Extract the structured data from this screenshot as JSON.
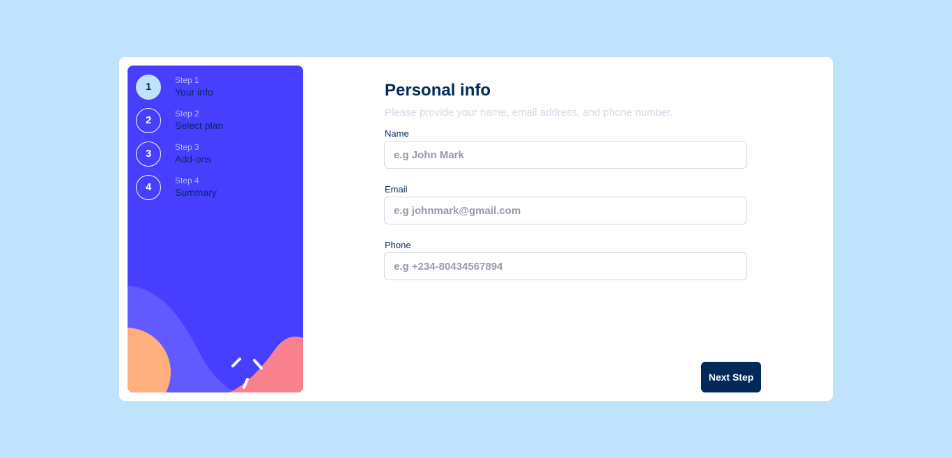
{
  "colors": {
    "page_background": "#bfe2fd",
    "sidebar_background": "#483eff",
    "marine_blue": "#02295a",
    "light_blue": "#bfe2fd",
    "border_gray": "#d6d9e6",
    "cool_gray": "#9699ab",
    "decor_orange": "#ffaf7e",
    "decor_pink": "#f9818e",
    "decor_purple": "#6259ff"
  },
  "steps": [
    {
      "number": "1",
      "label": "Step 1",
      "title": "Your info",
      "active": true
    },
    {
      "number": "2",
      "label": "Step 2",
      "title": "Select plan",
      "active": false
    },
    {
      "number": "3",
      "label": "Step 3",
      "title": "Add-ons",
      "active": false
    },
    {
      "number": "4",
      "label": "Step 4",
      "title": "Summary",
      "active": false
    }
  ],
  "form": {
    "title": "Personal info",
    "subtitle": "Please provide your name, email address, and phone number.",
    "fields": [
      {
        "label": "Name",
        "value": "",
        "placeholder": "e.g John Mark"
      },
      {
        "label": "Email",
        "value": "",
        "placeholder": "e.g johnmark@gmail.com"
      },
      {
        "label": "Phone",
        "value": "",
        "placeholder": "e.g +234-80434567894"
      }
    ]
  },
  "actions": {
    "next_label": "Next Step"
  }
}
